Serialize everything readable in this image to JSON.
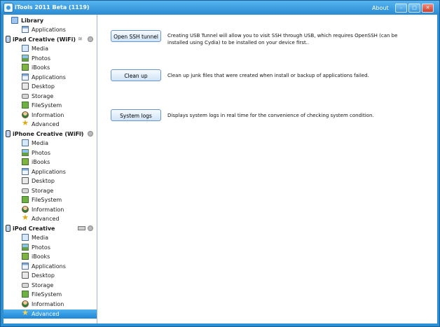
{
  "window": {
    "title": "iTools 2011 Beta (1119)",
    "about": "About",
    "controls": [
      "–",
      "□",
      "✕"
    ]
  },
  "sidebar": {
    "library": {
      "label": "Library",
      "items": [
        {
          "label": "Applications",
          "icon": "applications-icon"
        }
      ]
    },
    "devices": [
      {
        "name": "iPad Creative (WiFi)",
        "items": [
          {
            "label": "Media",
            "icon": "media-icon"
          },
          {
            "label": "Photos",
            "icon": "photos-icon"
          },
          {
            "label": "iBooks",
            "icon": "ibooks-icon"
          },
          {
            "label": "Applications",
            "icon": "applications-icon"
          },
          {
            "label": "Desktop",
            "icon": "desktop-icon"
          },
          {
            "label": "Storage",
            "icon": "storage-icon"
          },
          {
            "label": "FileSystem",
            "icon": "filesystem-icon"
          },
          {
            "label": "Information",
            "icon": "information-icon"
          },
          {
            "label": "Advanced",
            "icon": "advanced-icon"
          }
        ]
      },
      {
        "name": "iPhone Creative (WiFi)",
        "items": [
          {
            "label": "Media",
            "icon": "media-icon"
          },
          {
            "label": "Photos",
            "icon": "photos-icon"
          },
          {
            "label": "iBooks",
            "icon": "ibooks-icon"
          },
          {
            "label": "Applications",
            "icon": "applications-icon"
          },
          {
            "label": "Desktop",
            "icon": "desktop-icon"
          },
          {
            "label": "Storage",
            "icon": "storage-icon"
          },
          {
            "label": "FileSystem",
            "icon": "filesystem-icon"
          },
          {
            "label": "Information",
            "icon": "information-icon"
          },
          {
            "label": "Advanced",
            "icon": "advanced-icon"
          }
        ]
      },
      {
        "name": "iPod Creative",
        "items": [
          {
            "label": "Media",
            "icon": "media-icon"
          },
          {
            "label": "Photos",
            "icon": "photos-icon"
          },
          {
            "label": "iBooks",
            "icon": "ibooks-icon"
          },
          {
            "label": "Applications",
            "icon": "applications-icon"
          },
          {
            "label": "Desktop",
            "icon": "desktop-icon"
          },
          {
            "label": "Storage",
            "icon": "storage-icon"
          },
          {
            "label": "FileSystem",
            "icon": "filesystem-icon"
          },
          {
            "label": "Information",
            "icon": "information-icon"
          },
          {
            "label": "Advanced",
            "icon": "advanced-icon",
            "selected": true
          }
        ]
      }
    ]
  },
  "main": {
    "actions": [
      {
        "button": "Open SSH tunnel",
        "description": "Creating USB Tunnel will allow you to visit SSH through USB, which requires OpenSSH (can be installed using Cydia) to be installed on your device first.."
      },
      {
        "button": "Clean up",
        "description": "Clean up junk files that were created when install or backup of applications failed."
      },
      {
        "button": "System logs",
        "description": "Displays system logs in real time for the convenience of checking system condition."
      }
    ]
  },
  "colors": {
    "titlebar": "#2a8ad2",
    "selection": "#1f86d6",
    "accent": "#e0a70f"
  }
}
